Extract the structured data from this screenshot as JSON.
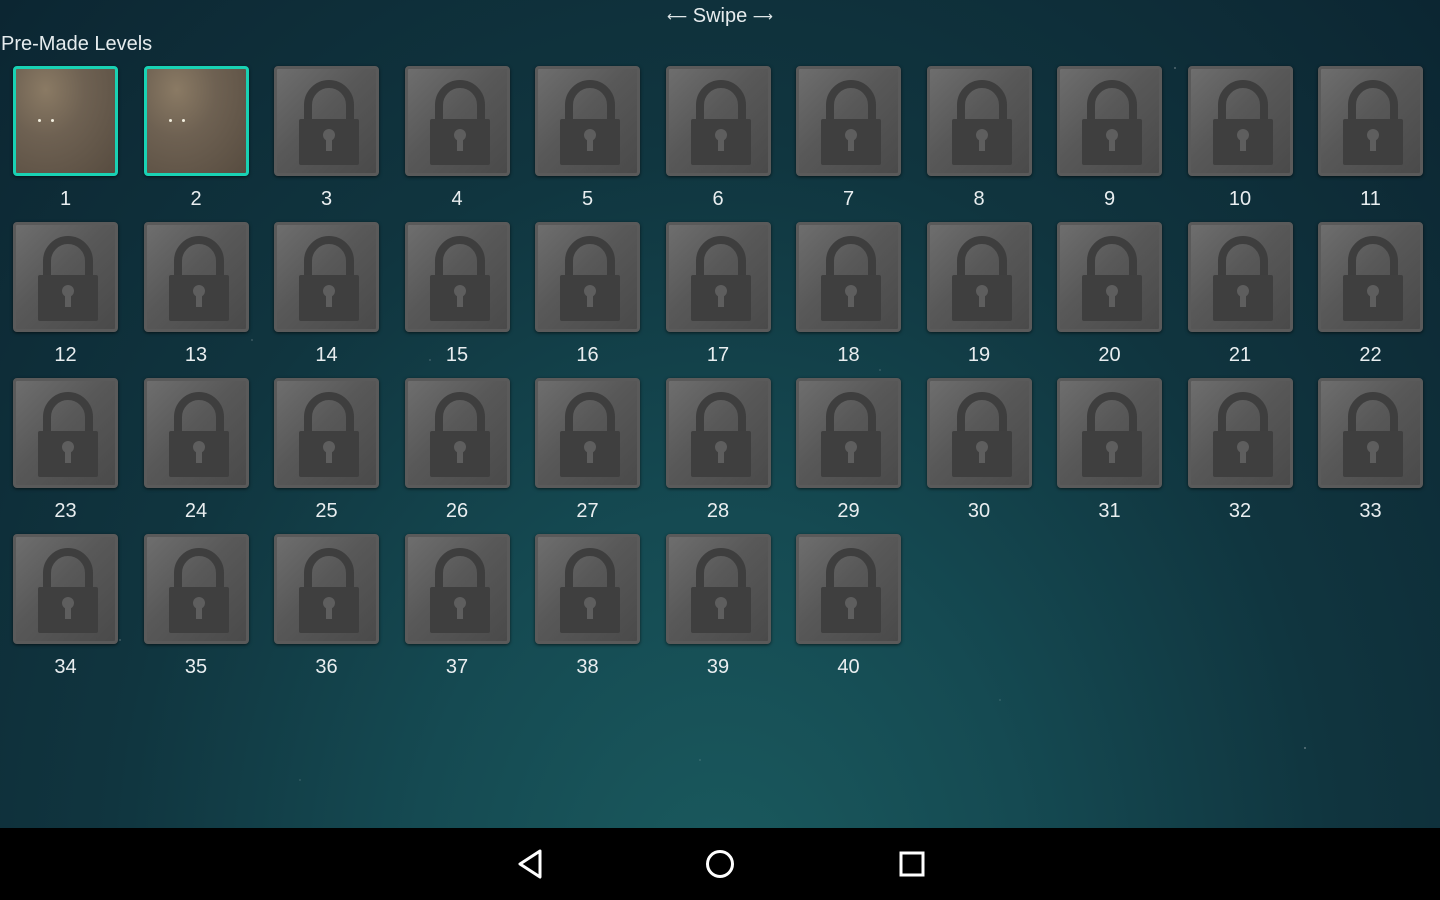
{
  "header": {
    "swipe_label": "Swipe",
    "left_arrow": "⟵",
    "right_arrow": "⟶"
  },
  "section": {
    "title": "Pre-Made Levels"
  },
  "levels": [
    {
      "number": "1",
      "locked": false
    },
    {
      "number": "2",
      "locked": false
    },
    {
      "number": "3",
      "locked": true
    },
    {
      "number": "4",
      "locked": true
    },
    {
      "number": "5",
      "locked": true
    },
    {
      "number": "6",
      "locked": true
    },
    {
      "number": "7",
      "locked": true
    },
    {
      "number": "8",
      "locked": true
    },
    {
      "number": "9",
      "locked": true
    },
    {
      "number": "10",
      "locked": true
    },
    {
      "number": "11",
      "locked": true
    },
    {
      "number": "12",
      "locked": true
    },
    {
      "number": "13",
      "locked": true
    },
    {
      "number": "14",
      "locked": true
    },
    {
      "number": "15",
      "locked": true
    },
    {
      "number": "16",
      "locked": true
    },
    {
      "number": "17",
      "locked": true
    },
    {
      "number": "18",
      "locked": true
    },
    {
      "number": "19",
      "locked": true
    },
    {
      "number": "20",
      "locked": true
    },
    {
      "number": "21",
      "locked": true
    },
    {
      "number": "22",
      "locked": true
    },
    {
      "number": "23",
      "locked": true
    },
    {
      "number": "24",
      "locked": true
    },
    {
      "number": "25",
      "locked": true
    },
    {
      "number": "26",
      "locked": true
    },
    {
      "number": "27",
      "locked": true
    },
    {
      "number": "28",
      "locked": true
    },
    {
      "number": "29",
      "locked": true
    },
    {
      "number": "30",
      "locked": true
    },
    {
      "number": "31",
      "locked": true
    },
    {
      "number": "32",
      "locked": true
    },
    {
      "number": "33",
      "locked": true
    },
    {
      "number": "34",
      "locked": true
    },
    {
      "number": "35",
      "locked": true
    },
    {
      "number": "36",
      "locked": true
    },
    {
      "number": "37",
      "locked": true
    },
    {
      "number": "38",
      "locked": true
    },
    {
      "number": "39",
      "locked": true
    },
    {
      "number": "40",
      "locked": true
    }
  ],
  "colors": {
    "selected_border": "#19d2b4",
    "locked_border": "#5a5a5a",
    "background": "#10353f",
    "navbar": "#000000"
  },
  "navbar": {
    "buttons": [
      {
        "icon": "back-icon"
      },
      {
        "icon": "home-icon"
      },
      {
        "icon": "recents-icon"
      }
    ]
  }
}
